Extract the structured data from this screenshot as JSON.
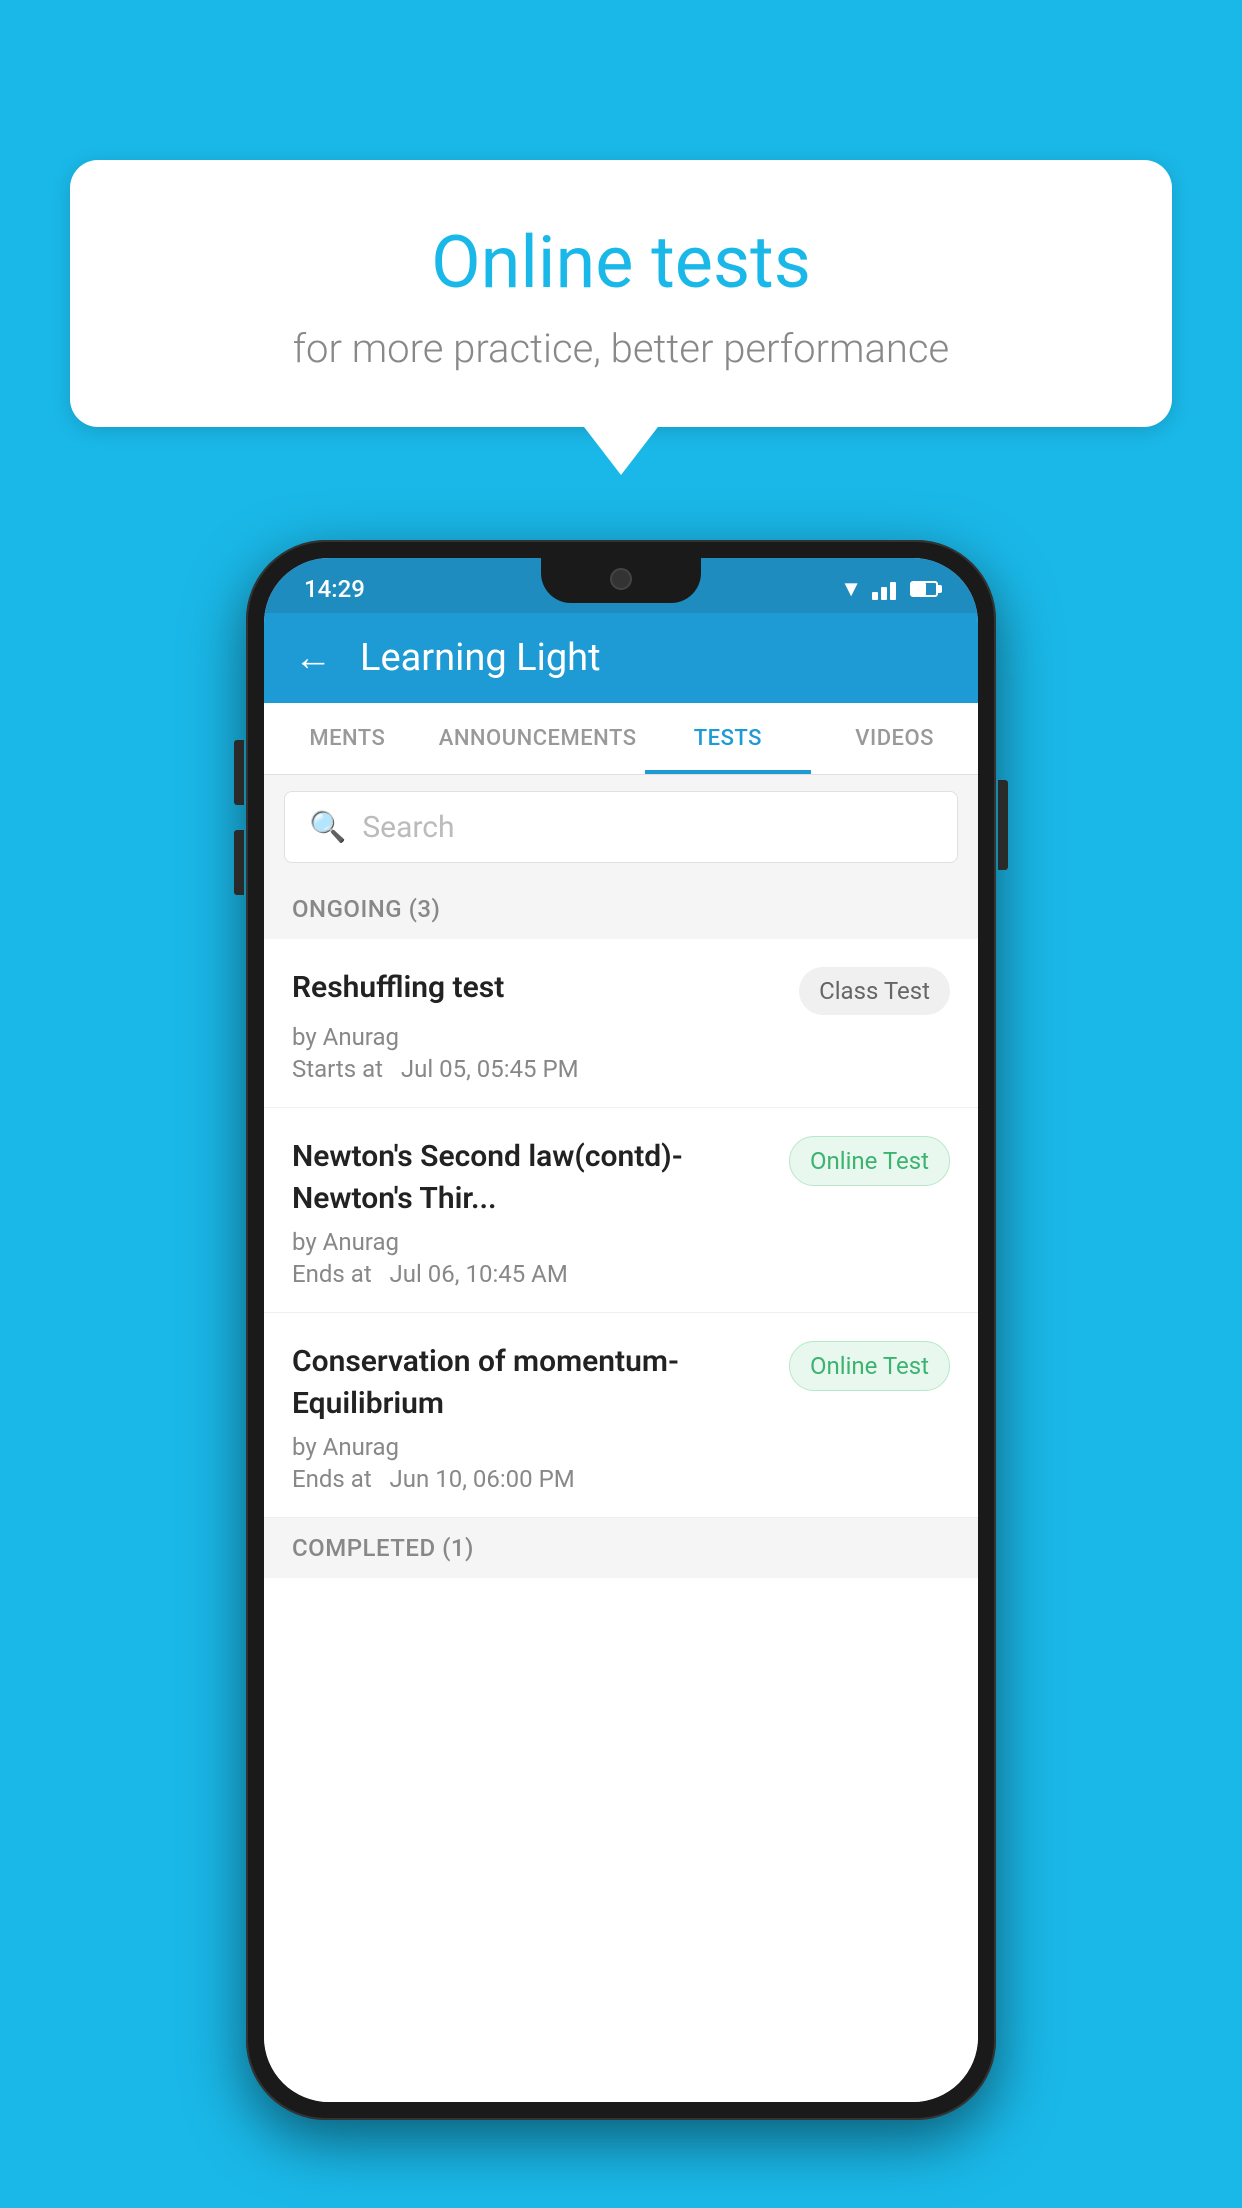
{
  "background": {
    "color": "#1ab8e8"
  },
  "speech_bubble": {
    "title": "Online tests",
    "subtitle": "for more practice, better performance"
  },
  "phone": {
    "status_bar": {
      "time": "14:29"
    },
    "app_bar": {
      "title": "Learning Light",
      "back_label": "←"
    },
    "tabs": [
      {
        "label": "MENTS",
        "active": false
      },
      {
        "label": "ANNOUNCEMENTS",
        "active": false
      },
      {
        "label": "TESTS",
        "active": true
      },
      {
        "label": "VIDEOS",
        "active": false
      }
    ],
    "search": {
      "placeholder": "Search"
    },
    "sections": [
      {
        "header": "ONGOING (3)",
        "tests": [
          {
            "name": "Reshuffling test",
            "badge": "Class Test",
            "badge_type": "class",
            "by": "by Anurag",
            "time_label": "Starts at",
            "time": "Jul 05, 05:45 PM"
          },
          {
            "name": "Newton's Second law(contd)-Newton's Thir...",
            "badge": "Online Test",
            "badge_type": "online",
            "by": "by Anurag",
            "time_label": "Ends at",
            "time": "Jul 06, 10:45 AM"
          },
          {
            "name": "Conservation of momentum-Equilibrium",
            "badge": "Online Test",
            "badge_type": "online",
            "by": "by Anurag",
            "time_label": "Ends at",
            "time": "Jun 10, 06:00 PM"
          }
        ]
      }
    ],
    "completed_section_header": "COMPLETED (1)"
  }
}
